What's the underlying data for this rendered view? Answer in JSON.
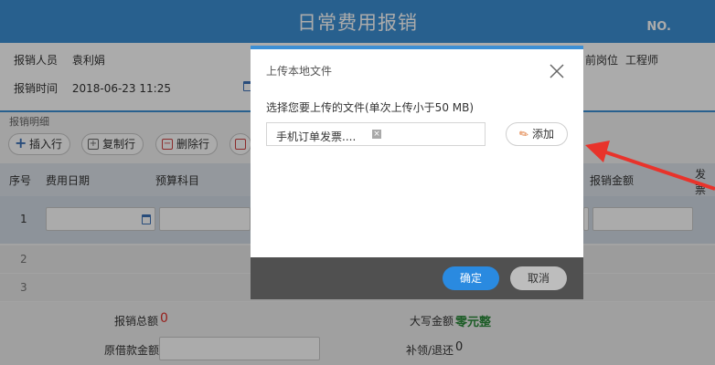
{
  "header": {
    "title": "日常费用报销",
    "no_label": "NO."
  },
  "info": {
    "person_label": "报销人员",
    "person_value": "袁利娟",
    "time_label": "报销时间",
    "time_value": "2018-06-23 11:25",
    "position_label_partial": "前岗位",
    "position_value": "工程师"
  },
  "section": {
    "title": "报销明细",
    "toolbar": [
      {
        "label": "插入行",
        "icon": "plus-icon"
      },
      {
        "label": "复制行",
        "icon": "copy-icon"
      },
      {
        "label": "删除行",
        "icon": "trash-icon"
      }
    ],
    "columns": {
      "seq": "序号",
      "date": "费用日期",
      "budget": "预算科目",
      "amount": "报销金额",
      "invoice_partial": "发票"
    },
    "rows": [
      {
        "num": "1"
      },
      {
        "num": "2"
      },
      {
        "num": "3"
      }
    ]
  },
  "summary": {
    "total_label": "报销总额",
    "total_value": "0",
    "capital_label": "大写金额",
    "capital_value": "零元整",
    "borrow_label": "原借款金额",
    "refund_label": "补领/退还",
    "refund_value": "0"
  },
  "modal": {
    "title": "上传本地文件",
    "prompt": "选择您要上传的文件(单次上传小于50 MB)",
    "file_name": "手机订单发票....",
    "add_label": "添加",
    "ok_label": "确定",
    "cancel_label": "取消"
  },
  "colors": {
    "primary": "#3d8fd4",
    "arrow": "#e8332b",
    "ok": "#2a8ae0"
  }
}
